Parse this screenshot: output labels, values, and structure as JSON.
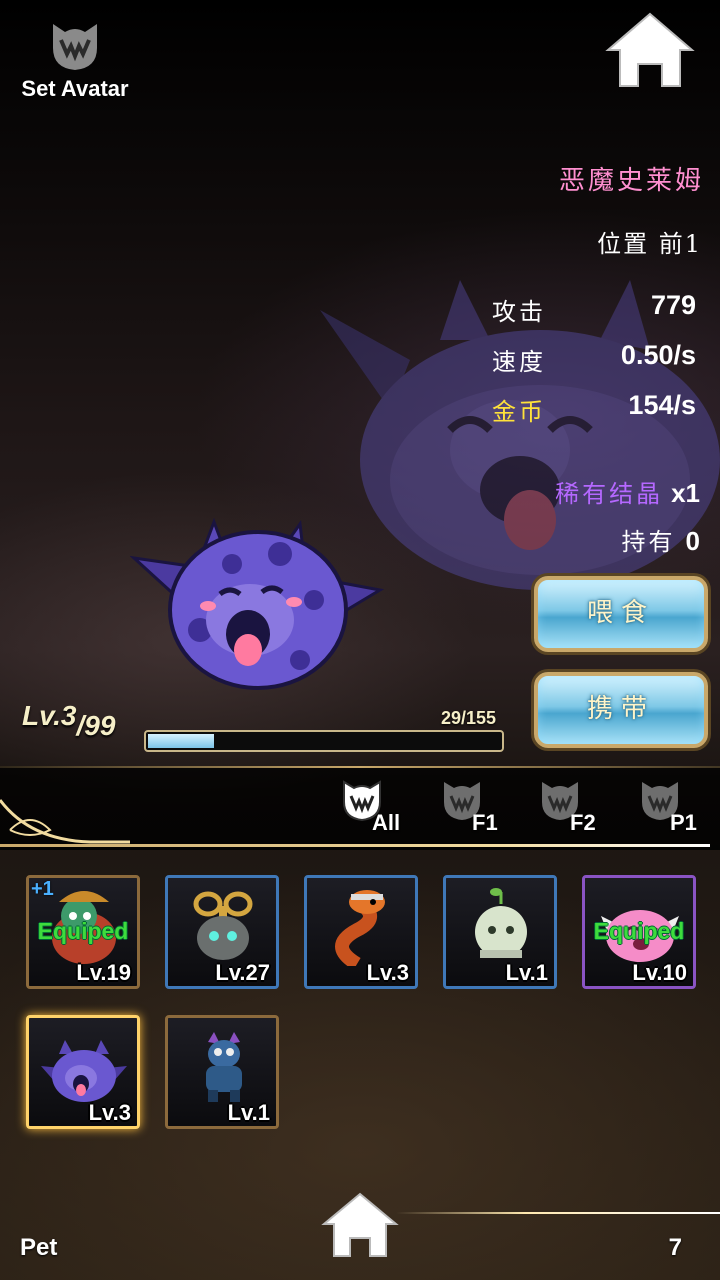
{
  "header": {
    "set_avatar_label": "Set Avatar"
  },
  "pet": {
    "name": "恶魔史莱姆",
    "position": "位置 前1",
    "stats": {
      "attack_label": "攻击",
      "attack_value": "779",
      "speed_label": "速度",
      "speed_value": "0.50/s",
      "gold_label": "金币",
      "gold_value": "154/s"
    },
    "rare_crystal_label": "稀有结晶",
    "rare_crystal_value": "x1",
    "owned_label": "持有",
    "owned_value": "0",
    "level_current": "Lv.3",
    "level_max": "/99",
    "exp_text": "29/155",
    "exp_fraction": 0.187
  },
  "actions": {
    "feed_label": "喂食",
    "carry_label": "携带"
  },
  "filters": [
    {
      "label": "All",
      "active": true
    },
    {
      "label": "F1",
      "active": false
    },
    {
      "label": "F2",
      "active": false
    },
    {
      "label": "P1",
      "active": false
    }
  ],
  "pets": [
    {
      "level": "Lv.19",
      "equipped": "Equiped",
      "plus": "+1",
      "frame": "brown",
      "art": "red-lizard-pet-icon"
    },
    {
      "level": "Lv.27",
      "frame": "blue",
      "art": "windup-robot-pet-icon"
    },
    {
      "level": "Lv.3",
      "frame": "blue",
      "art": "fire-serpent-pet-icon"
    },
    {
      "level": "Lv.1",
      "frame": "blue",
      "art": "sprout-bulb-pet-icon"
    },
    {
      "level": "Lv.10",
      "equipped": "Equiped",
      "frame": "purple",
      "art": "pink-winged-slime-pet-icon"
    },
    {
      "level": "Lv.3",
      "frame": "selected",
      "art": "demon-slime-pet-icon"
    },
    {
      "level": "Lv.1",
      "frame": "brown",
      "art": "blue-goblin-pet-icon"
    }
  ],
  "footer": {
    "label": "Pet",
    "count": "7"
  },
  "colors": {
    "name_pink": "#ff8fd0",
    "gold_yellow": "#ffe23a",
    "rare_purple": "#b568ff",
    "equipped_green": "#3ddc3d",
    "frame_gold": "#c9a86a"
  }
}
